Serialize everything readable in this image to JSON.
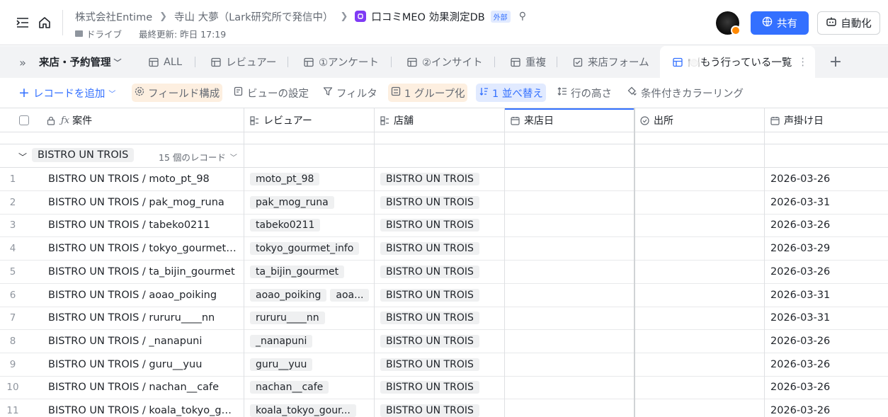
{
  "header": {
    "breadcrumb": [
      "株式会社Entime",
      "寺山 大夢（Lark研究所で発信中）"
    ],
    "doc_title": "口コミMEO 効果測定DB",
    "external_badge": "外部",
    "location": "ドライブ",
    "last_updated": "最終更新: 昨日 17:19",
    "share_label": "共有",
    "automation_label": "自動化"
  },
  "tabbar": {
    "table_name": "来店・予約管理",
    "tabs": [
      {
        "label": "ALL"
      },
      {
        "label": "レビュアー"
      },
      {
        "label": "①アンケート"
      },
      {
        "label": "②インサイト"
      },
      {
        "label": "重複"
      },
      {
        "label": "来店フォーム"
      },
      {
        "label": "🍽️もう行っている一覧"
      }
    ]
  },
  "toolbar": {
    "add_record": "レコードを追加",
    "field_config": "フィールド構成",
    "view_settings": "ビューの設定",
    "filter": "フィルタ",
    "group": "1 グループ化",
    "sort": "1 並べ替え",
    "row_height": "行の高さ",
    "conditional_color": "条件付きカラーリング"
  },
  "grid": {
    "columns": [
      "案件",
      "レビュアー",
      "店舗",
      "来店日",
      "出所",
      "声掛け日"
    ],
    "group": {
      "label": "BISTRO UN TROIS",
      "count": "15 個のレコード"
    },
    "rows": [
      {
        "num": "1",
        "title": "BISTRO UN TROIS / moto_pt_98",
        "reviewers": [
          "moto_pt_98"
        ],
        "shop": "BISTRO UN TROIS",
        "date": "2026-03-26"
      },
      {
        "num": "2",
        "title": "BISTRO UN TROIS / pak_mog_runa",
        "reviewers": [
          "pak_mog_runa"
        ],
        "shop": "BISTRO UN TROIS",
        "date": "2026-03-31"
      },
      {
        "num": "3",
        "title": "BISTRO UN TROIS / tabeko0211",
        "reviewers": [
          "tabeko0211"
        ],
        "shop": "BISTRO UN TROIS",
        "date": "2026-03-26"
      },
      {
        "num": "4",
        "title": "BISTRO UN TROIS / tokyo_gourmet_info",
        "reviewers": [
          "tokyo_gourmet_info"
        ],
        "shop": "BISTRO UN TROIS",
        "date": "2026-03-29"
      },
      {
        "num": "5",
        "title": "BISTRO UN TROIS / ta_bijin_gourmet",
        "reviewers": [
          "ta_bijin_gourmet"
        ],
        "shop": "BISTRO UN TROIS",
        "date": "2026-03-26"
      },
      {
        "num": "6",
        "title": "BISTRO UN TROIS / aoao_poiking",
        "reviewers": [
          "aoao_poiking",
          "aoa..."
        ],
        "shop": "BISTRO UN TROIS",
        "date": "2026-03-31"
      },
      {
        "num": "7",
        "title": "BISTRO UN TROIS / rururu____nn",
        "reviewers": [
          "rururu____nn"
        ],
        "shop": "BISTRO UN TROIS",
        "date": "2026-03-31"
      },
      {
        "num": "8",
        "title": "BISTRO UN TROIS / _nanapuni",
        "reviewers": [
          "_nanapuni"
        ],
        "shop": "BISTRO UN TROIS",
        "date": "2026-03-26"
      },
      {
        "num": "9",
        "title": "BISTRO UN TROIS / guru__yuu",
        "reviewers": [
          "guru__yuu"
        ],
        "shop": "BISTRO UN TROIS",
        "date": "2026-03-26"
      },
      {
        "num": "10",
        "title": "BISTRO UN TROIS / nachan__cafe",
        "reviewers": [
          "nachan__cafe"
        ],
        "shop": "BISTRO UN TROIS",
        "date": "2026-03-26"
      },
      {
        "num": "11",
        "title": "BISTRO UN TROIS / koala_tokyo_gourmet",
        "reviewers": [
          "koala_tokyo_gour..."
        ],
        "shop": "BISTRO UN TROIS",
        "date": "2026-03-26"
      }
    ]
  },
  "colors": {
    "accent": "#3370ff",
    "doc_icon": "#7f3bf5",
    "avatar_status": "#ff8800"
  },
  "icons": [
    "sidebar-toggle-icon",
    "home-icon",
    "globe-icon",
    "robot-icon",
    "table-grid-icon",
    "form-icon",
    "lookup-icon",
    "date-icon",
    "select-icon",
    "lock-icon",
    "formula-icon"
  ]
}
